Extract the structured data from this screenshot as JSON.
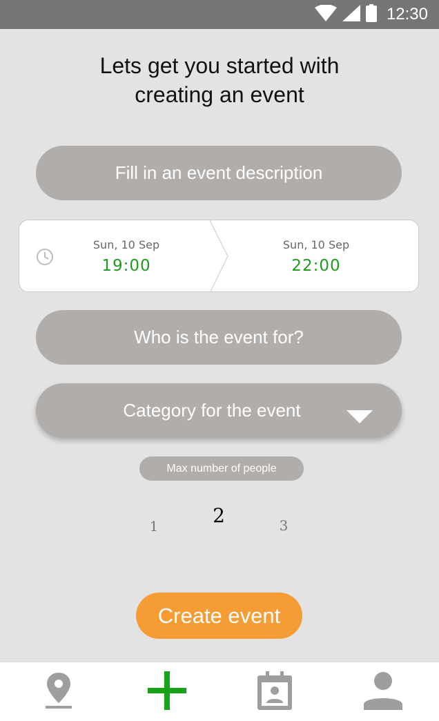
{
  "status_bar": {
    "time": "12:30",
    "icons": [
      "wifi-icon",
      "signal-icon",
      "battery-icon"
    ]
  },
  "headline": {
    "line1": "Lets get you started with",
    "line2": "creating an event"
  },
  "description_button": {
    "label": "Fill in an event description"
  },
  "datetime": {
    "start": {
      "date": "Sun, 10 Sep",
      "time": "19:00"
    },
    "end": {
      "date": "Sun, 10 Sep",
      "time": "22:00"
    }
  },
  "audience_button": {
    "label": "Who is the event for?"
  },
  "category_dropdown": {
    "label": "Category for the event"
  },
  "max_people": {
    "label": "Max number of people",
    "options": [
      "1",
      "2",
      "3"
    ],
    "selected": "2"
  },
  "create_button": {
    "label": "Create event"
  },
  "bottom_nav": {
    "items": [
      {
        "icon": "map-pin-icon",
        "active": false
      },
      {
        "icon": "plus-icon",
        "active": true
      },
      {
        "icon": "calendar-contact-icon",
        "active": false
      },
      {
        "icon": "person-icon",
        "active": false
      }
    ]
  },
  "colors": {
    "status_bar": "#757575",
    "background": "#e3e3e3",
    "pill": "#b0adab",
    "time_green": "#1f9a1f",
    "accent_orange": "#f59c35",
    "nav_active": "#1aa31a",
    "nav_icon": "#9e9e9e"
  }
}
